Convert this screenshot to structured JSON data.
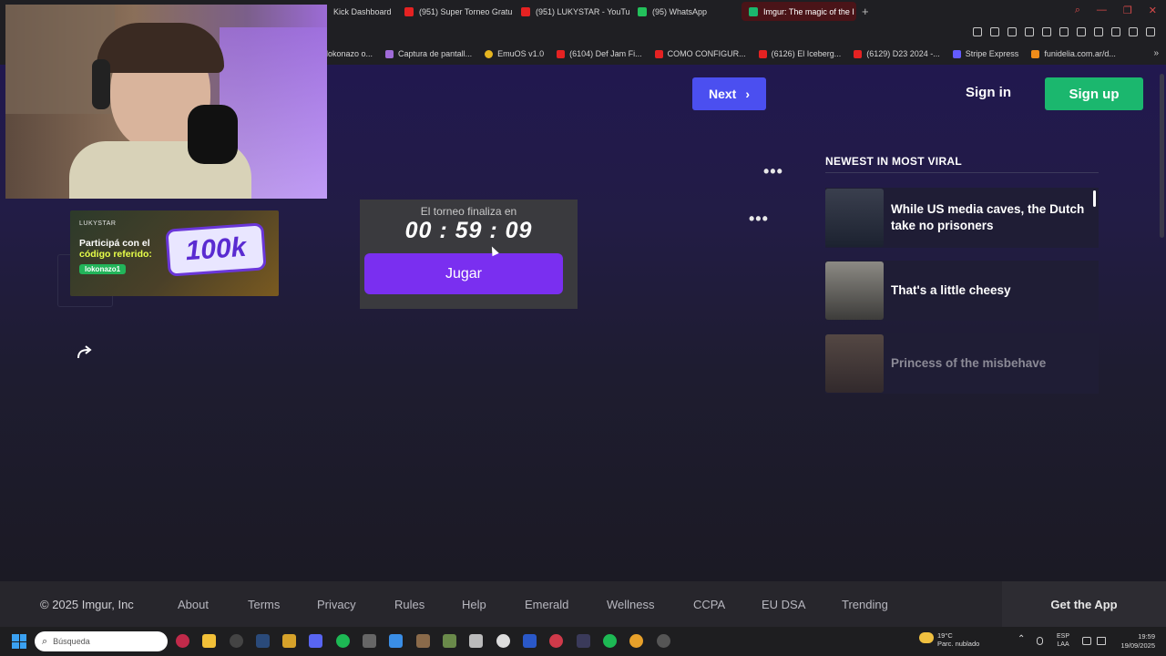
{
  "browser": {
    "tabs": [
      {
        "label": "Kick Dashboard",
        "favicon": "kick-icon",
        "active": false
      },
      {
        "label": "(951) Super Torneo Gratu",
        "favicon": "youtube-icon",
        "active": false
      },
      {
        "label": "(951) LUKYSTAR - YouTu",
        "favicon": "youtube-icon",
        "active": false
      },
      {
        "label": "(95) WhatsApp",
        "favicon": "whatsapp-icon",
        "active": false
      },
      {
        "label": "Imgur: The magic of the I",
        "favicon": "imgur-icon",
        "active": true
      }
    ],
    "new_tab": "+",
    "bookmarks": [
      {
        "label": "lokonazo o...",
        "favicon": "generic-icon"
      },
      {
        "label": "Captura de pantall...",
        "favicon": "pen-icon"
      },
      {
        "label": "EmuOS v1.0",
        "favicon": "emu-icon"
      },
      {
        "label": "(6104) Def Jam Fi...",
        "favicon": "youtube-icon"
      },
      {
        "label": "COMO CONFIGUR...",
        "favicon": "youtube-icon"
      },
      {
        "label": "(6126) El Iceberg...",
        "favicon": "youtube-icon"
      },
      {
        "label": "(6129) D23 2024 -...",
        "favicon": "youtube-icon"
      },
      {
        "label": "Stripe Express",
        "favicon": "stripe-icon"
      },
      {
        "label": "funidelia.com.ar/d...",
        "favicon": "funidelia-icon"
      }
    ],
    "bookmarks_more": "»"
  },
  "header": {
    "next_label": "Next",
    "signin_label": "Sign in",
    "signup_label": "Sign up"
  },
  "sidebar": {
    "title": "NEWEST IN MOST VIRAL",
    "items": [
      {
        "title": "While US media caves, the Dutch take no prisoners",
        "dim": false
      },
      {
        "title": "That's a little cheesy",
        "dim": false
      },
      {
        "title": "Princess of the misbehave",
        "dim": true
      }
    ]
  },
  "more_menu": "•••",
  "ad": {
    "brand": "LUKYSTAR",
    "line1": "Participá con el",
    "line2": "código referido:",
    "code": "lokonazo1",
    "amount": "100k"
  },
  "timer": {
    "label": "El torneo finaliza en",
    "value": "00 : 59 : 09",
    "button": "Jugar"
  },
  "footer": {
    "copyright": "© 2025 Imgur, Inc",
    "links": [
      "About",
      "Terms",
      "Privacy",
      "Rules",
      "Help",
      "Emerald",
      "Wellness",
      "CCPA",
      "EU DSA",
      "Trending"
    ],
    "get_app": "Get the App"
  },
  "taskbar": {
    "search_placeholder": "Búsqueda",
    "weather_temp": "19°C",
    "weather_desc": "Parc. nublado",
    "lang_top": "ESP",
    "lang_bottom": "LAA",
    "time": "19:59",
    "date": "19/09/2025"
  },
  "colors": {
    "next_button": "#4b4ff0",
    "signup_button": "#1bb76e",
    "jugar_button": "#7a2ff0"
  }
}
